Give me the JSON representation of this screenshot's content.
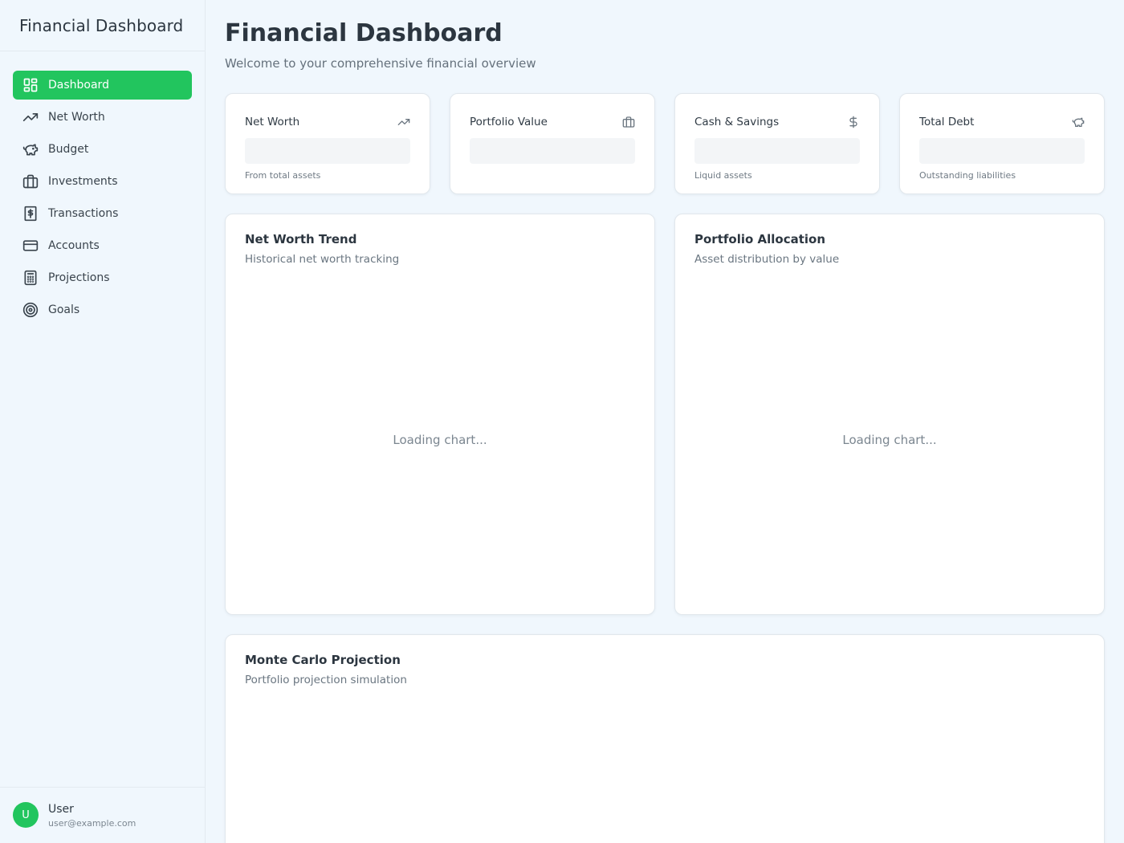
{
  "sidebar": {
    "brand": "Financial Dashboard",
    "items": [
      {
        "label": "Dashboard",
        "icon": "dashboard-grid-icon",
        "active": true
      },
      {
        "label": "Net Worth",
        "icon": "trending-up-icon"
      },
      {
        "label": "Budget",
        "icon": "piggy-bank-icon"
      },
      {
        "label": "Investments",
        "icon": "briefcase-icon"
      },
      {
        "label": "Transactions",
        "icon": "receipt-dollar-icon"
      },
      {
        "label": "Accounts",
        "icon": "credit-card-icon"
      },
      {
        "label": "Projections",
        "icon": "calculator-icon"
      },
      {
        "label": "Goals",
        "icon": "target-icon"
      }
    ],
    "user": {
      "initial": "U",
      "name": "User",
      "email": "user@example.com"
    }
  },
  "header": {
    "title": "Financial Dashboard",
    "subtitle": "Welcome to your comprehensive financial overview"
  },
  "stats": [
    {
      "title": "Net Worth",
      "subtitle": "From total assets",
      "icon": "trending-up-icon"
    },
    {
      "title": "Portfolio Value",
      "subtitle": "",
      "icon": "briefcase-icon"
    },
    {
      "title": "Cash & Savings",
      "subtitle": "Liquid assets",
      "icon": "dollar-icon"
    },
    {
      "title": "Total Debt",
      "subtitle": "Outstanding liabilities",
      "icon": "piggy-bank-icon"
    }
  ],
  "charts": [
    {
      "title": "Net Worth Trend",
      "subtitle": "Historical net worth tracking",
      "status": "Loading chart..."
    },
    {
      "title": "Portfolio Allocation",
      "subtitle": "Asset distribution by value",
      "status": "Loading chart..."
    }
  ],
  "projection": {
    "title": "Monte Carlo Projection",
    "subtitle": "Portfolio projection simulation"
  },
  "colors": {
    "accent": "#22c55e",
    "background": "#f0f7fd",
    "card": "#ffffff",
    "skeleton": "#f3f5f7"
  }
}
